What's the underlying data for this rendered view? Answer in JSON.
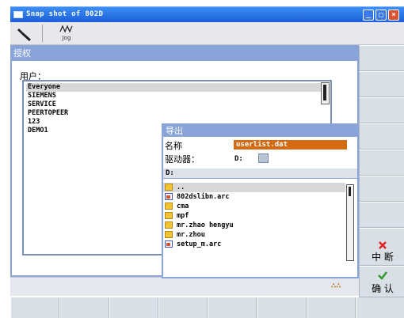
{
  "window": {
    "title": "Snap shot of 802D"
  },
  "toolbar": {
    "jog_label": "Jog"
  },
  "panel": {
    "header": "授权",
    "users_label": "用户：",
    "users": [
      "Everyone",
      "SIEMENS",
      "SERVICE",
      "PEERTOPEER",
      "123",
      "DEMO1"
    ]
  },
  "export_dialog": {
    "title": "导出",
    "name_label": "名称",
    "name_value": "userlist.dat",
    "drive_label": "驱动器：",
    "drive_value": "D:",
    "path": "D:",
    "files": [
      {
        "name": "..",
        "icon": "folder-icon"
      },
      {
        "name": "802dslibn.arc",
        "icon": "archive-icon"
      },
      {
        "name": "cma",
        "icon": "folder-icon"
      },
      {
        "name": "mpf",
        "icon": "folder-icon"
      },
      {
        "name": "mr.zhao hengyu",
        "icon": "folder-icon"
      },
      {
        "name": "mr.zhou",
        "icon": "folder-icon"
      },
      {
        "name": "setup_m.arc",
        "icon": "archive-icon"
      }
    ]
  },
  "softkeys": {
    "cancel": "中 断",
    "confirm": "确 认"
  },
  "colors": {
    "header": "#88a4d8",
    "selection": "#d46a12",
    "titlebar": "#1c5fd8"
  }
}
